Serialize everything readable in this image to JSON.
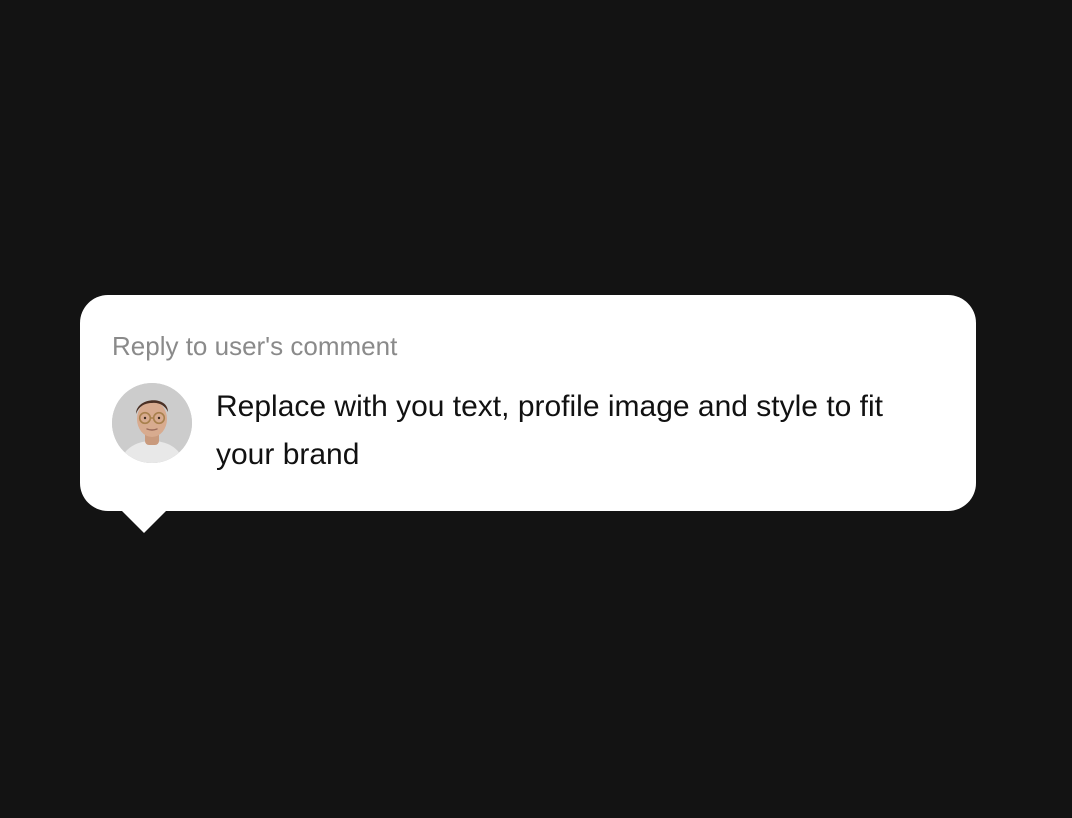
{
  "comment_bubble": {
    "reply_label": "Reply to user's comment",
    "comment_text": "Replace with you text, profile image and style to fit your brand",
    "avatar_icon": "user-avatar-photo"
  },
  "colors": {
    "background": "#131313",
    "bubble": "#ffffff",
    "label": "#8a8a8a",
    "text": "#111111"
  }
}
